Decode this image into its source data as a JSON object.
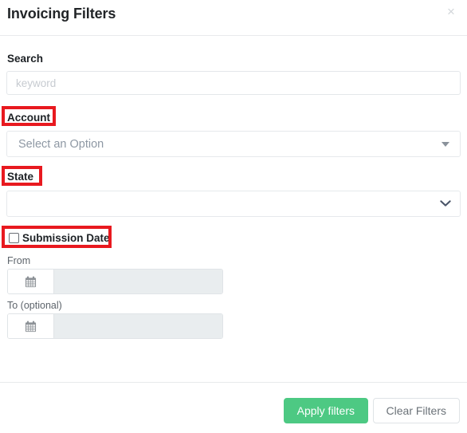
{
  "header": {
    "title": "Invoicing Filters",
    "close_label": "×",
    "close_icon": "close-icon"
  },
  "form": {
    "search": {
      "label": "Search",
      "placeholder": "keyword",
      "value": ""
    },
    "account": {
      "label": "Account",
      "selected_value": "Select an Option",
      "caret_icon": "triangle-down-icon",
      "highlighted": true
    },
    "state": {
      "label": "State",
      "selected_value": "",
      "caret_icon": "chevron-down-icon",
      "highlighted": true
    },
    "submission_date": {
      "label": "Submission Date",
      "checked": false,
      "highlighted": true,
      "from": {
        "label": "From",
        "value": "",
        "icon": "calendar-icon"
      },
      "to": {
        "label": "To (optional)",
        "value": "",
        "icon": "calendar-icon"
      }
    }
  },
  "footer": {
    "apply_label": "Apply filters",
    "clear_label": "Clear Filters"
  },
  "colors": {
    "accent_green": "#4dc983",
    "annotation_red": "#e8191f",
    "label_text": "#1d2125",
    "placeholder": "#c7cbd1",
    "disabled_field": "#e9edef"
  }
}
